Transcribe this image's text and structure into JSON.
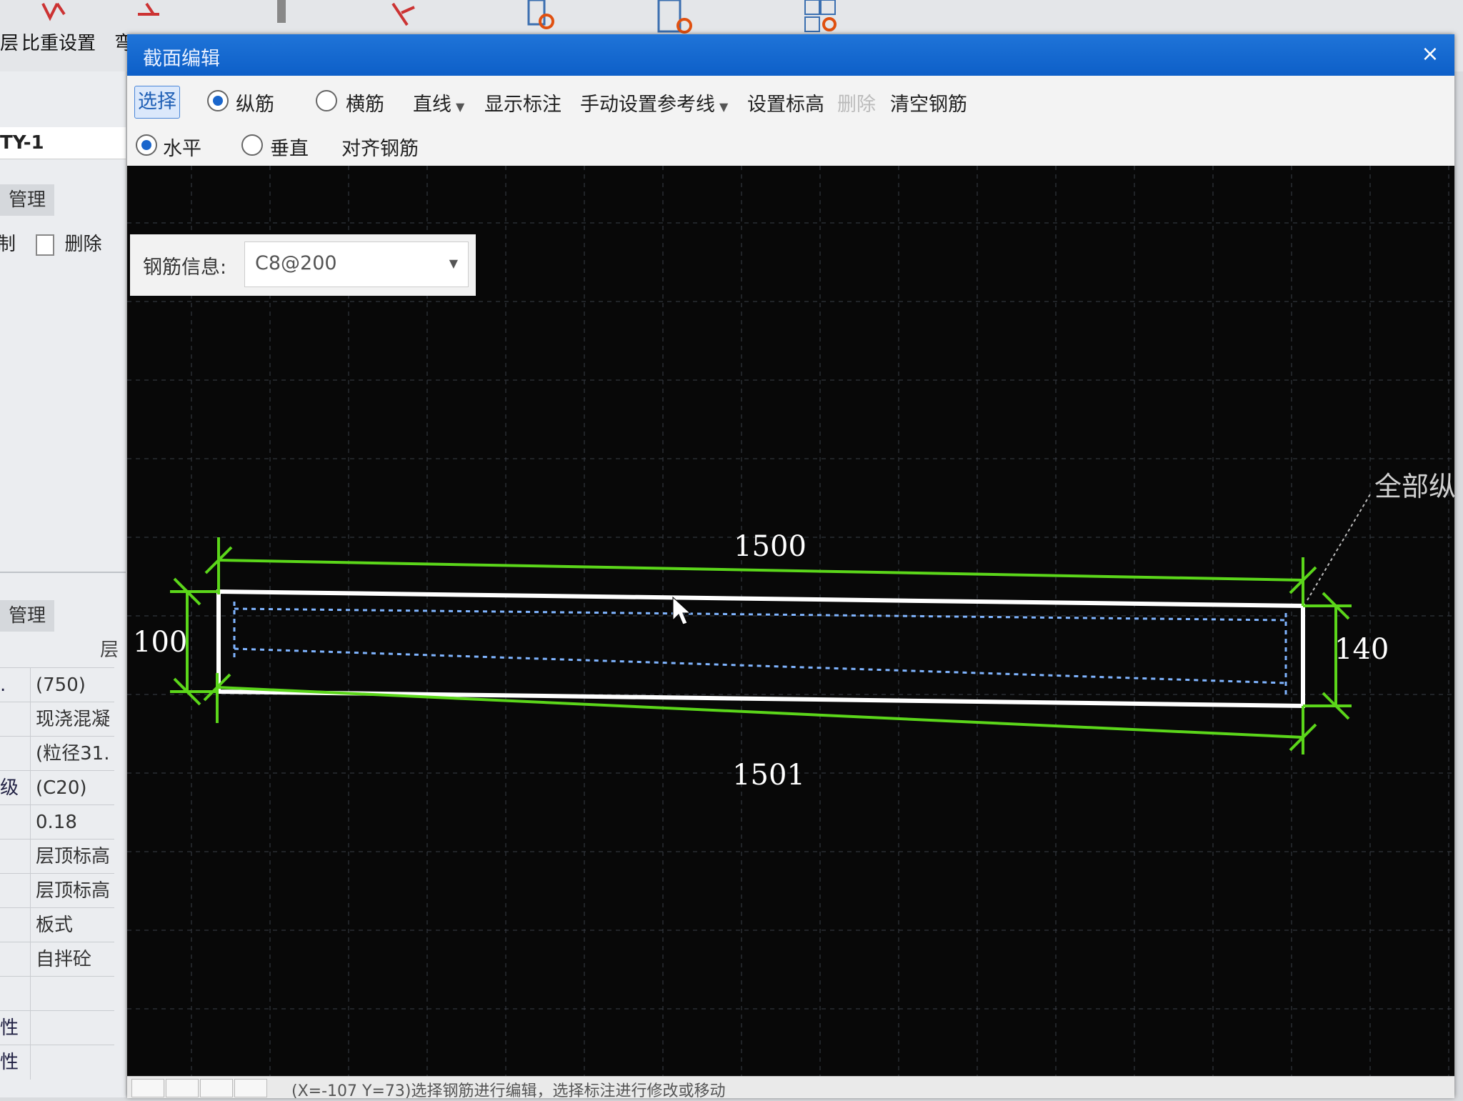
{
  "ribbon": {
    "labels": [
      "层",
      "比重设置",
      "弯"
    ]
  },
  "left_panel": {
    "code": "TY-1",
    "tab1": "管理",
    "copy_label": "复制",
    "delete_label": "删除",
    "tab2": "管理",
    "header_value": "层",
    "rows": [
      {
        "k": ".",
        "v": "(750)"
      },
      {
        "k": "",
        "v": "现浇混凝"
      },
      {
        "k": "",
        "v": "(粒径31."
      },
      {
        "k": "级",
        "v": "(C20)"
      },
      {
        "k": "",
        "v": "0.18"
      },
      {
        "k": "",
        "v": "层顶标高"
      },
      {
        "k": "",
        "v": "层顶标高"
      },
      {
        "k": "",
        "v": "板式"
      },
      {
        "k": "",
        "v": "自拌砼"
      },
      {
        "k": "",
        "v": ""
      },
      {
        "k": "性",
        "v": ""
      },
      {
        "k": "性",
        "v": ""
      }
    ]
  },
  "dialog": {
    "title": "截面编辑",
    "close_symbol": "×",
    "toolbar": {
      "select": "选择",
      "longitudinal": "纵筋",
      "transverse": "横筋",
      "line": "直线",
      "show_dims": "显示标注",
      "manual_ref": "手动设置参考线",
      "set_elevation": "设置标高",
      "delete": "删除",
      "clear_rebar": "清空钢筋"
    },
    "toolbar2": {
      "horizontal": "水平",
      "vertical": "垂直",
      "align": "对齐钢筋"
    },
    "rebar_info": {
      "label": "钢筋信息:",
      "value": "C8@200"
    },
    "drawing": {
      "dim_top": "1500",
      "dim_bottom": "1501",
      "dim_left": "100",
      "dim_right": "140",
      "callout": "全部纵"
    },
    "status": "(X=-107 Y=73)选择钢筋进行编辑，选择标注进行修改或移动"
  },
  "colors": {
    "title_bar": "#1f74d8",
    "canvas_bg": "#080808",
    "dimension": "#5bd61a",
    "outline": "#ffffff",
    "rebar": "#7fb4ff"
  }
}
